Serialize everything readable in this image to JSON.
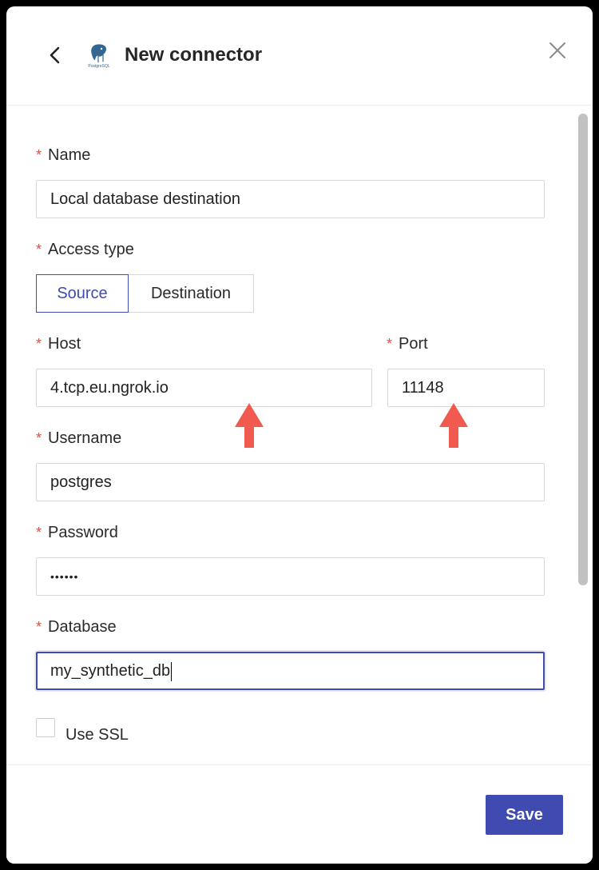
{
  "header": {
    "title": "New connector",
    "logo_text": "PostgreSQL",
    "back_icon": "chevron-left-icon",
    "close_icon": "close-icon"
  },
  "form": {
    "name": {
      "label": "Name",
      "value": "Local database destination"
    },
    "access_type": {
      "label": "Access type",
      "options": [
        "Source",
        "Destination"
      ],
      "selected": "Source"
    },
    "host": {
      "label": "Host",
      "value": "4.tcp.eu.ngrok.io"
    },
    "port": {
      "label": "Port",
      "value": "11148"
    },
    "username": {
      "label": "Username",
      "value": "postgres"
    },
    "password": {
      "label": "Password",
      "value": "••••••"
    },
    "database": {
      "label": "Database",
      "value": "my_synthetic_db"
    },
    "use_ssl": {
      "label": "Use SSL",
      "checked": false
    },
    "required_marker": "*"
  },
  "footer": {
    "save_label": "Save"
  },
  "colors": {
    "accent": "#3f4bb0",
    "required": "#e74c3c",
    "annotation_arrow": "#f05a4f"
  }
}
